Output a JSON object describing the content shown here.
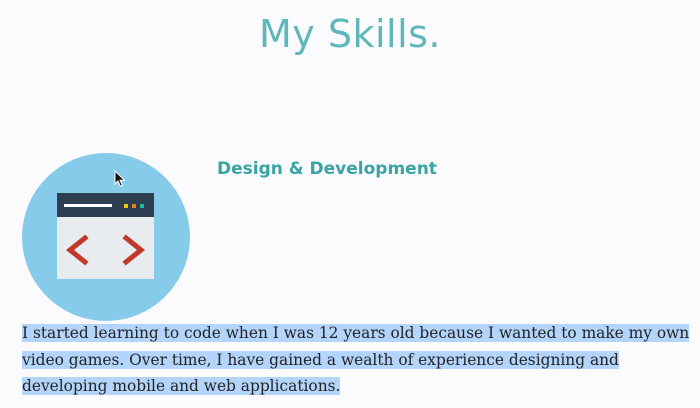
{
  "header": {
    "title": "My Skills."
  },
  "skills": [
    {
      "icon": "code-window-icon",
      "heading": "Design & Development",
      "description": "I started learning to code when I was 12 years old because I wanted to make my own video games. Over time, I have gained a wealth of experience designing and developing mobile and web applications."
    }
  ],
  "colors": {
    "accent": "#5eb8ba",
    "heading": "#3aa3a4",
    "icon_circle": "#87cbea",
    "icon_window_bar": "#2d3e50",
    "icon_window_body": "#e9ecee",
    "icon_brackets": "#c0392b",
    "selection": "#b3d4fb"
  }
}
